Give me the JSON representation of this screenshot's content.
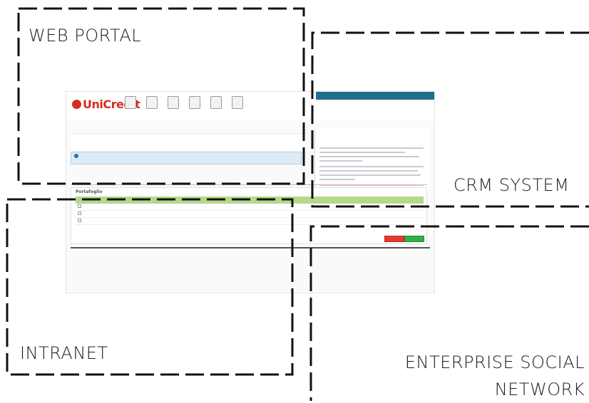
{
  "regions": {
    "web_portal": "WEB PORTAL",
    "crm_system": "CRM SYSTEM",
    "intranet": "INTRANET",
    "enterprise_social_network_line1": "ENTERPRISE SOCIAL",
    "enterprise_social_network_line2": "NETWORK"
  },
  "screenshot": {
    "logo": "UniCredit",
    "table_title": "Portafoglio"
  }
}
